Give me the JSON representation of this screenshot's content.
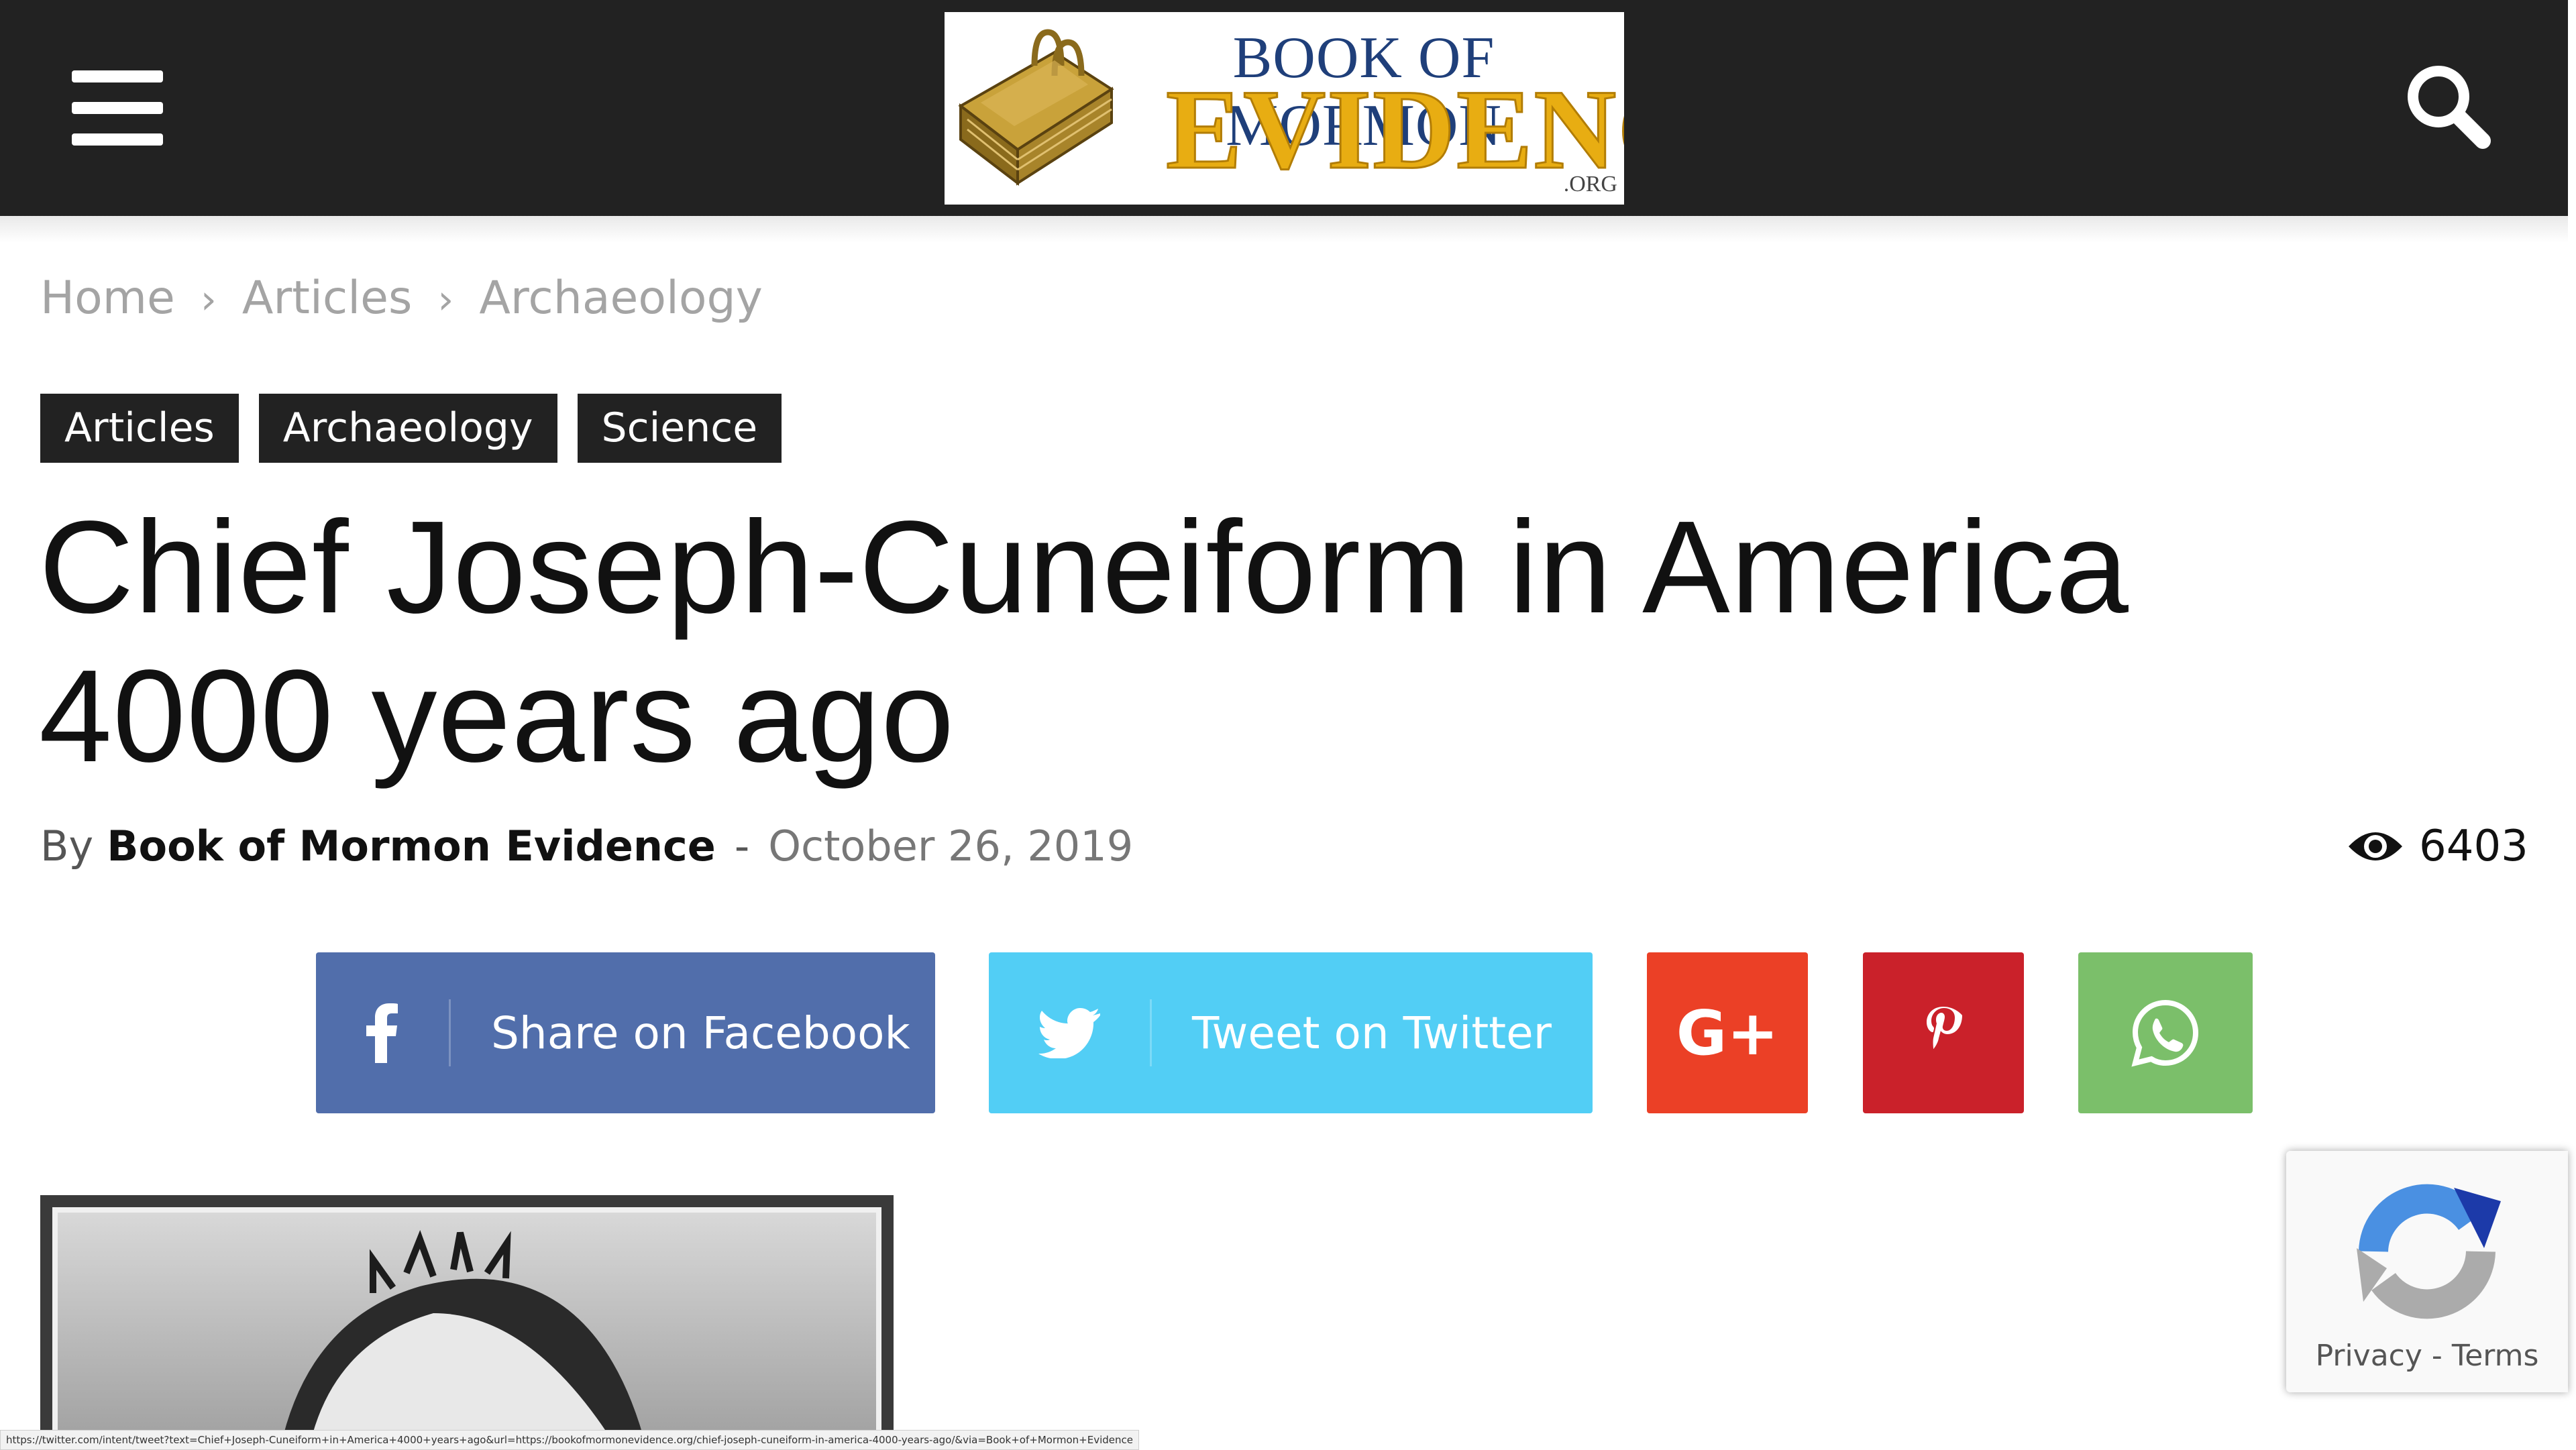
{
  "header": {
    "logo": {
      "line1": "BOOK OF MORMON",
      "line2": "EVIDENCE",
      "line3": ".ORG"
    },
    "menu_icon": "hamburger-menu-icon",
    "search_icon": "search-icon"
  },
  "breadcrumb": {
    "items": [
      "Home",
      "Articles",
      "Archaeology"
    ],
    "separator": "›"
  },
  "categories": [
    "Articles",
    "Archaeology",
    "Science"
  ],
  "article": {
    "title": "Chief Joseph-Cuneiform in America 4000 years ago",
    "by_label": "By",
    "author": "Book of Mormon Evidence",
    "dash": "-",
    "date": "October 26, 2019",
    "views": "6403"
  },
  "share": {
    "facebook_label": "Share on Facebook",
    "twitter_label": "Tweet on Twitter",
    "googleplus_text": "G+",
    "colors": {
      "facebook": "#516eab",
      "twitter": "#52cef5",
      "googleplus": "#eb4026",
      "pinterest": "#ca212a",
      "whatsapp": "#7bbf6a"
    }
  },
  "recaptcha": {
    "privacy": "Privacy",
    "separator": "-",
    "terms": "Terms"
  },
  "status_url": "https://twitter.com/intent/tweet?text=Chief+Joseph-Cuneiform+in+America+4000+years+ago&url=https://bookofmormonevidence.org/chief-joseph-cuneiform-in-america-4000-years-ago/&via=Book+of+Mormon+Evidence"
}
